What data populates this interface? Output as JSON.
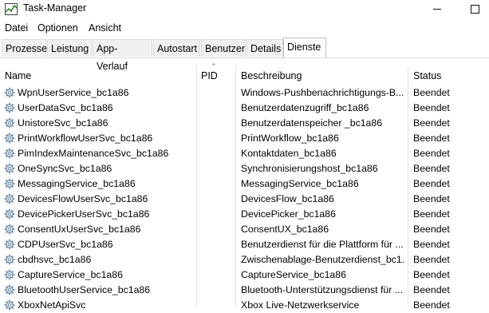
{
  "window": {
    "title": "Task-Manager"
  },
  "menu": [
    "Datei",
    "Optionen",
    "Ansicht"
  ],
  "tabs": [
    "Prozesse",
    "Leistung",
    "App-Verlauf",
    "Autostart",
    "Benutzer",
    "Details",
    "Dienste"
  ],
  "active_tab": "Dienste",
  "columns": {
    "name": "Name",
    "pid": "PID",
    "description": "Beschreibung",
    "status": "Status"
  },
  "services": [
    {
      "name": "WpnUserService_bc1a86",
      "pid": "",
      "description": "Windows-Pushbenachrichtigungs-B...",
      "status": "Beendet"
    },
    {
      "name": "UserDataSvc_bc1a86",
      "pid": "",
      "description": "Benutzerdatenzugriff_bc1a86",
      "status": "Beendet"
    },
    {
      "name": "UnistoreSvc_bc1a86",
      "pid": "",
      "description": "Benutzerdatenspeicher _bc1a86",
      "status": "Beendet"
    },
    {
      "name": "PrintWorkflowUserSvc_bc1a86",
      "pid": "",
      "description": "PrintWorkflow_bc1a86",
      "status": "Beendet"
    },
    {
      "name": "PimIndexMaintenanceSvc_bc1a86",
      "pid": "",
      "description": "Kontaktdaten_bc1a86",
      "status": "Beendet"
    },
    {
      "name": "OneSyncSvc_bc1a86",
      "pid": "",
      "description": "Synchronisierungshost_bc1a86",
      "status": "Beendet"
    },
    {
      "name": "MessagingService_bc1a86",
      "pid": "",
      "description": "MessagingService_bc1a86",
      "status": "Beendet"
    },
    {
      "name": "DevicesFlowUserSvc_bc1a86",
      "pid": "",
      "description": "DevicesFlow_bc1a86",
      "status": "Beendet"
    },
    {
      "name": "DevicePickerUserSvc_bc1a86",
      "pid": "",
      "description": "DevicePicker_bc1a86",
      "status": "Beendet"
    },
    {
      "name": "ConsentUxUserSvc_bc1a86",
      "pid": "",
      "description": "ConsentUX_bc1a86",
      "status": "Beendet"
    },
    {
      "name": "CDPUserSvc_bc1a86",
      "pid": "",
      "description": "Benutzerdienst für die Plattform für ...",
      "status": "Beendet"
    },
    {
      "name": "cbdhsvc_bc1a86",
      "pid": "",
      "description": "Zwischenablage-Benutzerdienst_bc1...",
      "status": "Beendet"
    },
    {
      "name": "CaptureService_bc1a86",
      "pid": "",
      "description": "CaptureService_bc1a86",
      "status": "Beendet"
    },
    {
      "name": "BluetoothUserService_bc1a86",
      "pid": "",
      "description": "Bluetooth-Unterstützungsdienst für ...",
      "status": "Beendet"
    },
    {
      "name": "XboxNetApiSvc",
      "pid": "",
      "description": "Xbox Live-Netzwerkservice",
      "status": "Beendet"
    }
  ],
  "icons": {
    "app": "task-manager-icon",
    "service": "gear-service-icon",
    "minimize": "minimize-icon",
    "maximize": "maximize-icon",
    "sort": "sort-ascending-icon"
  }
}
